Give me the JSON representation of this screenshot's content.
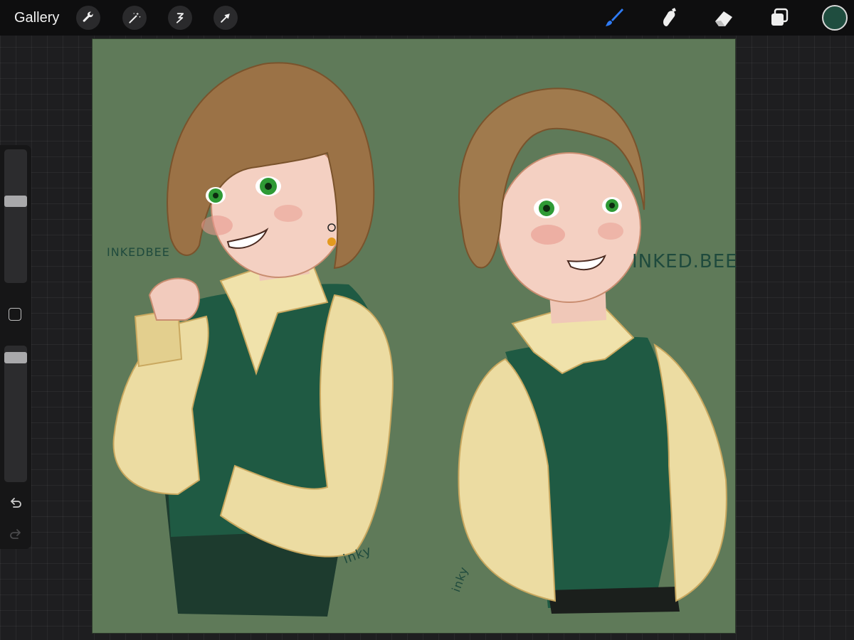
{
  "toolbar": {
    "gallery_label": "Gallery",
    "actions": [
      {
        "name": "wrench-icon",
        "label": "Actions"
      },
      {
        "name": "magic-wand-icon",
        "label": "Adjustments"
      },
      {
        "name": "selection-icon",
        "label": "Selection"
      },
      {
        "name": "arrow-cursor-icon",
        "label": "Transform"
      }
    ],
    "paint_tools": [
      {
        "name": "brush-icon",
        "active": true
      },
      {
        "name": "smudge-icon",
        "active": false
      },
      {
        "name": "eraser-icon",
        "active": false
      },
      {
        "name": "layers-icon",
        "active": false
      }
    ],
    "current_color": "#1f4d3f",
    "accent_color": "#2f7bf5"
  },
  "sidebar": {
    "brush_size_level": 0.62,
    "opacity_level": 0.95,
    "undo_icon": "undo-icon",
    "redo_icon": "redo-icon"
  },
  "canvas": {
    "background_color": "#5f7a59",
    "signatures": [
      "INKEDBEE",
      "INKED.BEE",
      "inky",
      "inky"
    ]
  }
}
